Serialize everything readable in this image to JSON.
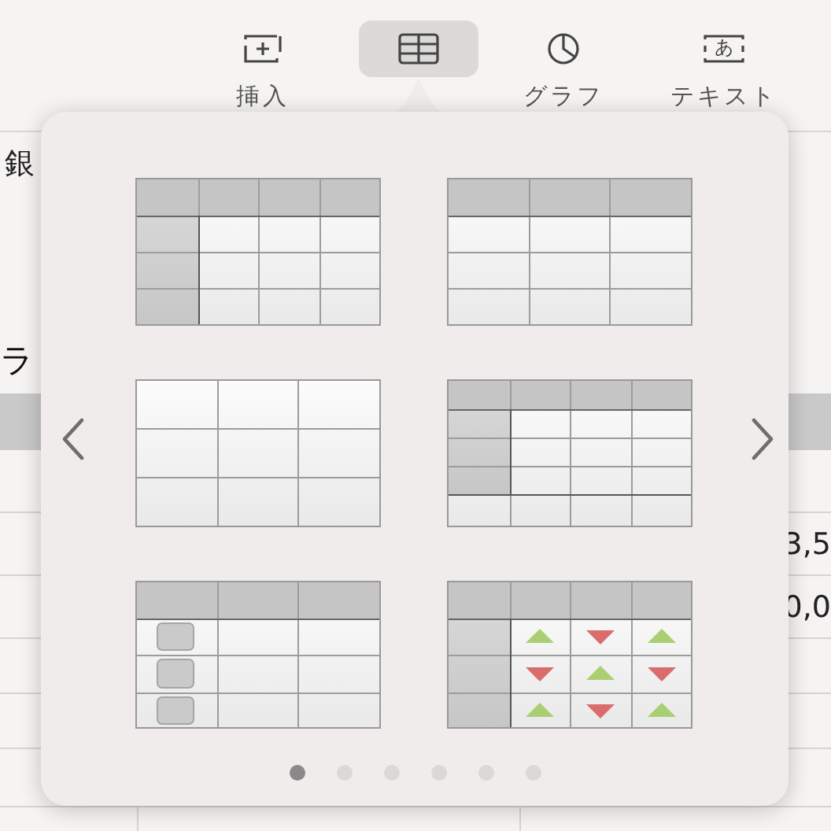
{
  "toolbar": {
    "items": [
      {
        "kind": "insert",
        "label": "挿入",
        "selected": false
      },
      {
        "kind": "table",
        "selected": true
      },
      {
        "kind": "chart",
        "label": "グラフ",
        "selected": false
      },
      {
        "kind": "text",
        "label": "テキスト",
        "icon_text": "あ",
        "selected": false
      }
    ]
  },
  "sheet": {
    "left_texts": [
      "銀",
      "ラ"
    ],
    "right_values": [
      "3,5",
      "0,0"
    ]
  },
  "table_styles": [
    {
      "kind": "header-row-column"
    },
    {
      "kind": "header-row"
    },
    {
      "kind": "plain"
    },
    {
      "kind": "header-footer"
    },
    {
      "kind": "checkbox"
    },
    {
      "kind": "arrows"
    }
  ],
  "pages": [
    {
      "selected": true
    },
    {
      "selected": false
    },
    {
      "selected": false
    },
    {
      "selected": false
    },
    {
      "selected": false
    },
    {
      "selected": false
    }
  ]
}
